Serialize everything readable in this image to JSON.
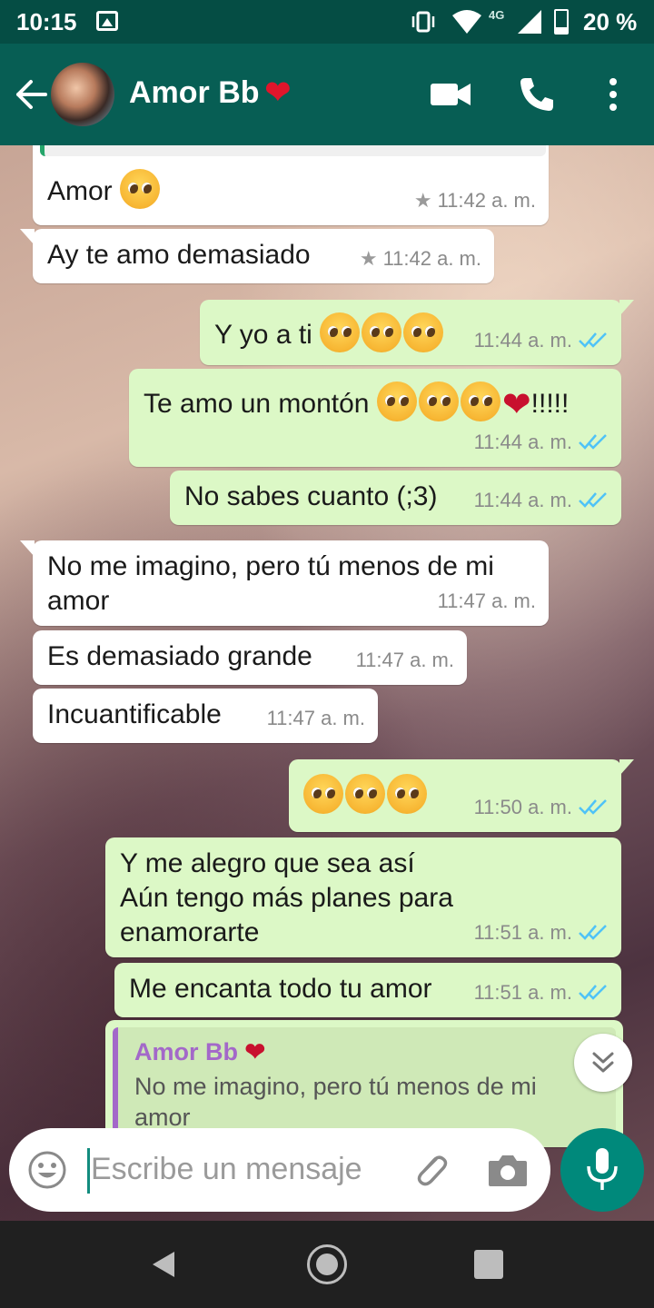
{
  "status_bar": {
    "time": "10:15",
    "network": "4G",
    "battery_percent": "20 %",
    "battery_level": 0.2
  },
  "header": {
    "contact_name": "Amor Bb",
    "name_emoji": "❤",
    "icons": [
      "back-arrow-icon",
      "avatar",
      "video-call-icon",
      "phone-call-icon",
      "more-vert-icon"
    ]
  },
  "messages": [
    {
      "dir": "in",
      "text": "Amor",
      "emojis": 1,
      "time": "11:42 a. m.",
      "starred": true
    },
    {
      "dir": "in",
      "text": "Ay te amo demasiado",
      "time": "11:42 a. m.",
      "starred": true
    },
    {
      "dir": "out",
      "text": "Y yo a ti",
      "emojis": 3,
      "time": "11:44 a. m.",
      "read": true
    },
    {
      "dir": "out",
      "text": "Te amo un montón",
      "emojis": 3,
      "suffix": "!!!!!",
      "time": "11:44 a. m.",
      "read": true
    },
    {
      "dir": "out",
      "text": "No sabes cuanto (;3)",
      "time": "11:44 a. m.",
      "read": true
    },
    {
      "dir": "in",
      "text": "No me imagino, pero tú menos de mi\namor",
      "time": "11:47 a. m."
    },
    {
      "dir": "in",
      "text": "Es demasiado grande",
      "time": "11:47 a. m."
    },
    {
      "dir": "in",
      "text": "Incuantificable",
      "time": "11:47 a. m."
    },
    {
      "dir": "out",
      "text": "",
      "emojis": 3,
      "time": "11:50 a. m.",
      "read": true
    },
    {
      "dir": "out",
      "text": "Y me alegro que sea así\nAún tengo más planes para\nenamorarte",
      "time": "11:51 a. m.",
      "read": true
    },
    {
      "dir": "out",
      "text": "Me encanta todo tu amor",
      "time": "11:51 a. m.",
      "read": true
    }
  ],
  "reply_preview": {
    "name": "Amor Bb",
    "name_emoji": "❤",
    "text": "No me imagino, pero tú menos de mi\namor"
  },
  "composer": {
    "placeholder": "Escribe un mensaje",
    "icons": [
      "emoji-icon",
      "attach-icon",
      "camera-icon",
      "mic-icon"
    ]
  },
  "colors": {
    "header": "#075e54",
    "status_bar": "#054d44",
    "outgoing_bubble": "#dcf8c6",
    "incoming_bubble": "#ffffff",
    "read_ticks": "#4fc3f7",
    "mic_button": "#00897b",
    "reply_accent": "#a368c9"
  }
}
